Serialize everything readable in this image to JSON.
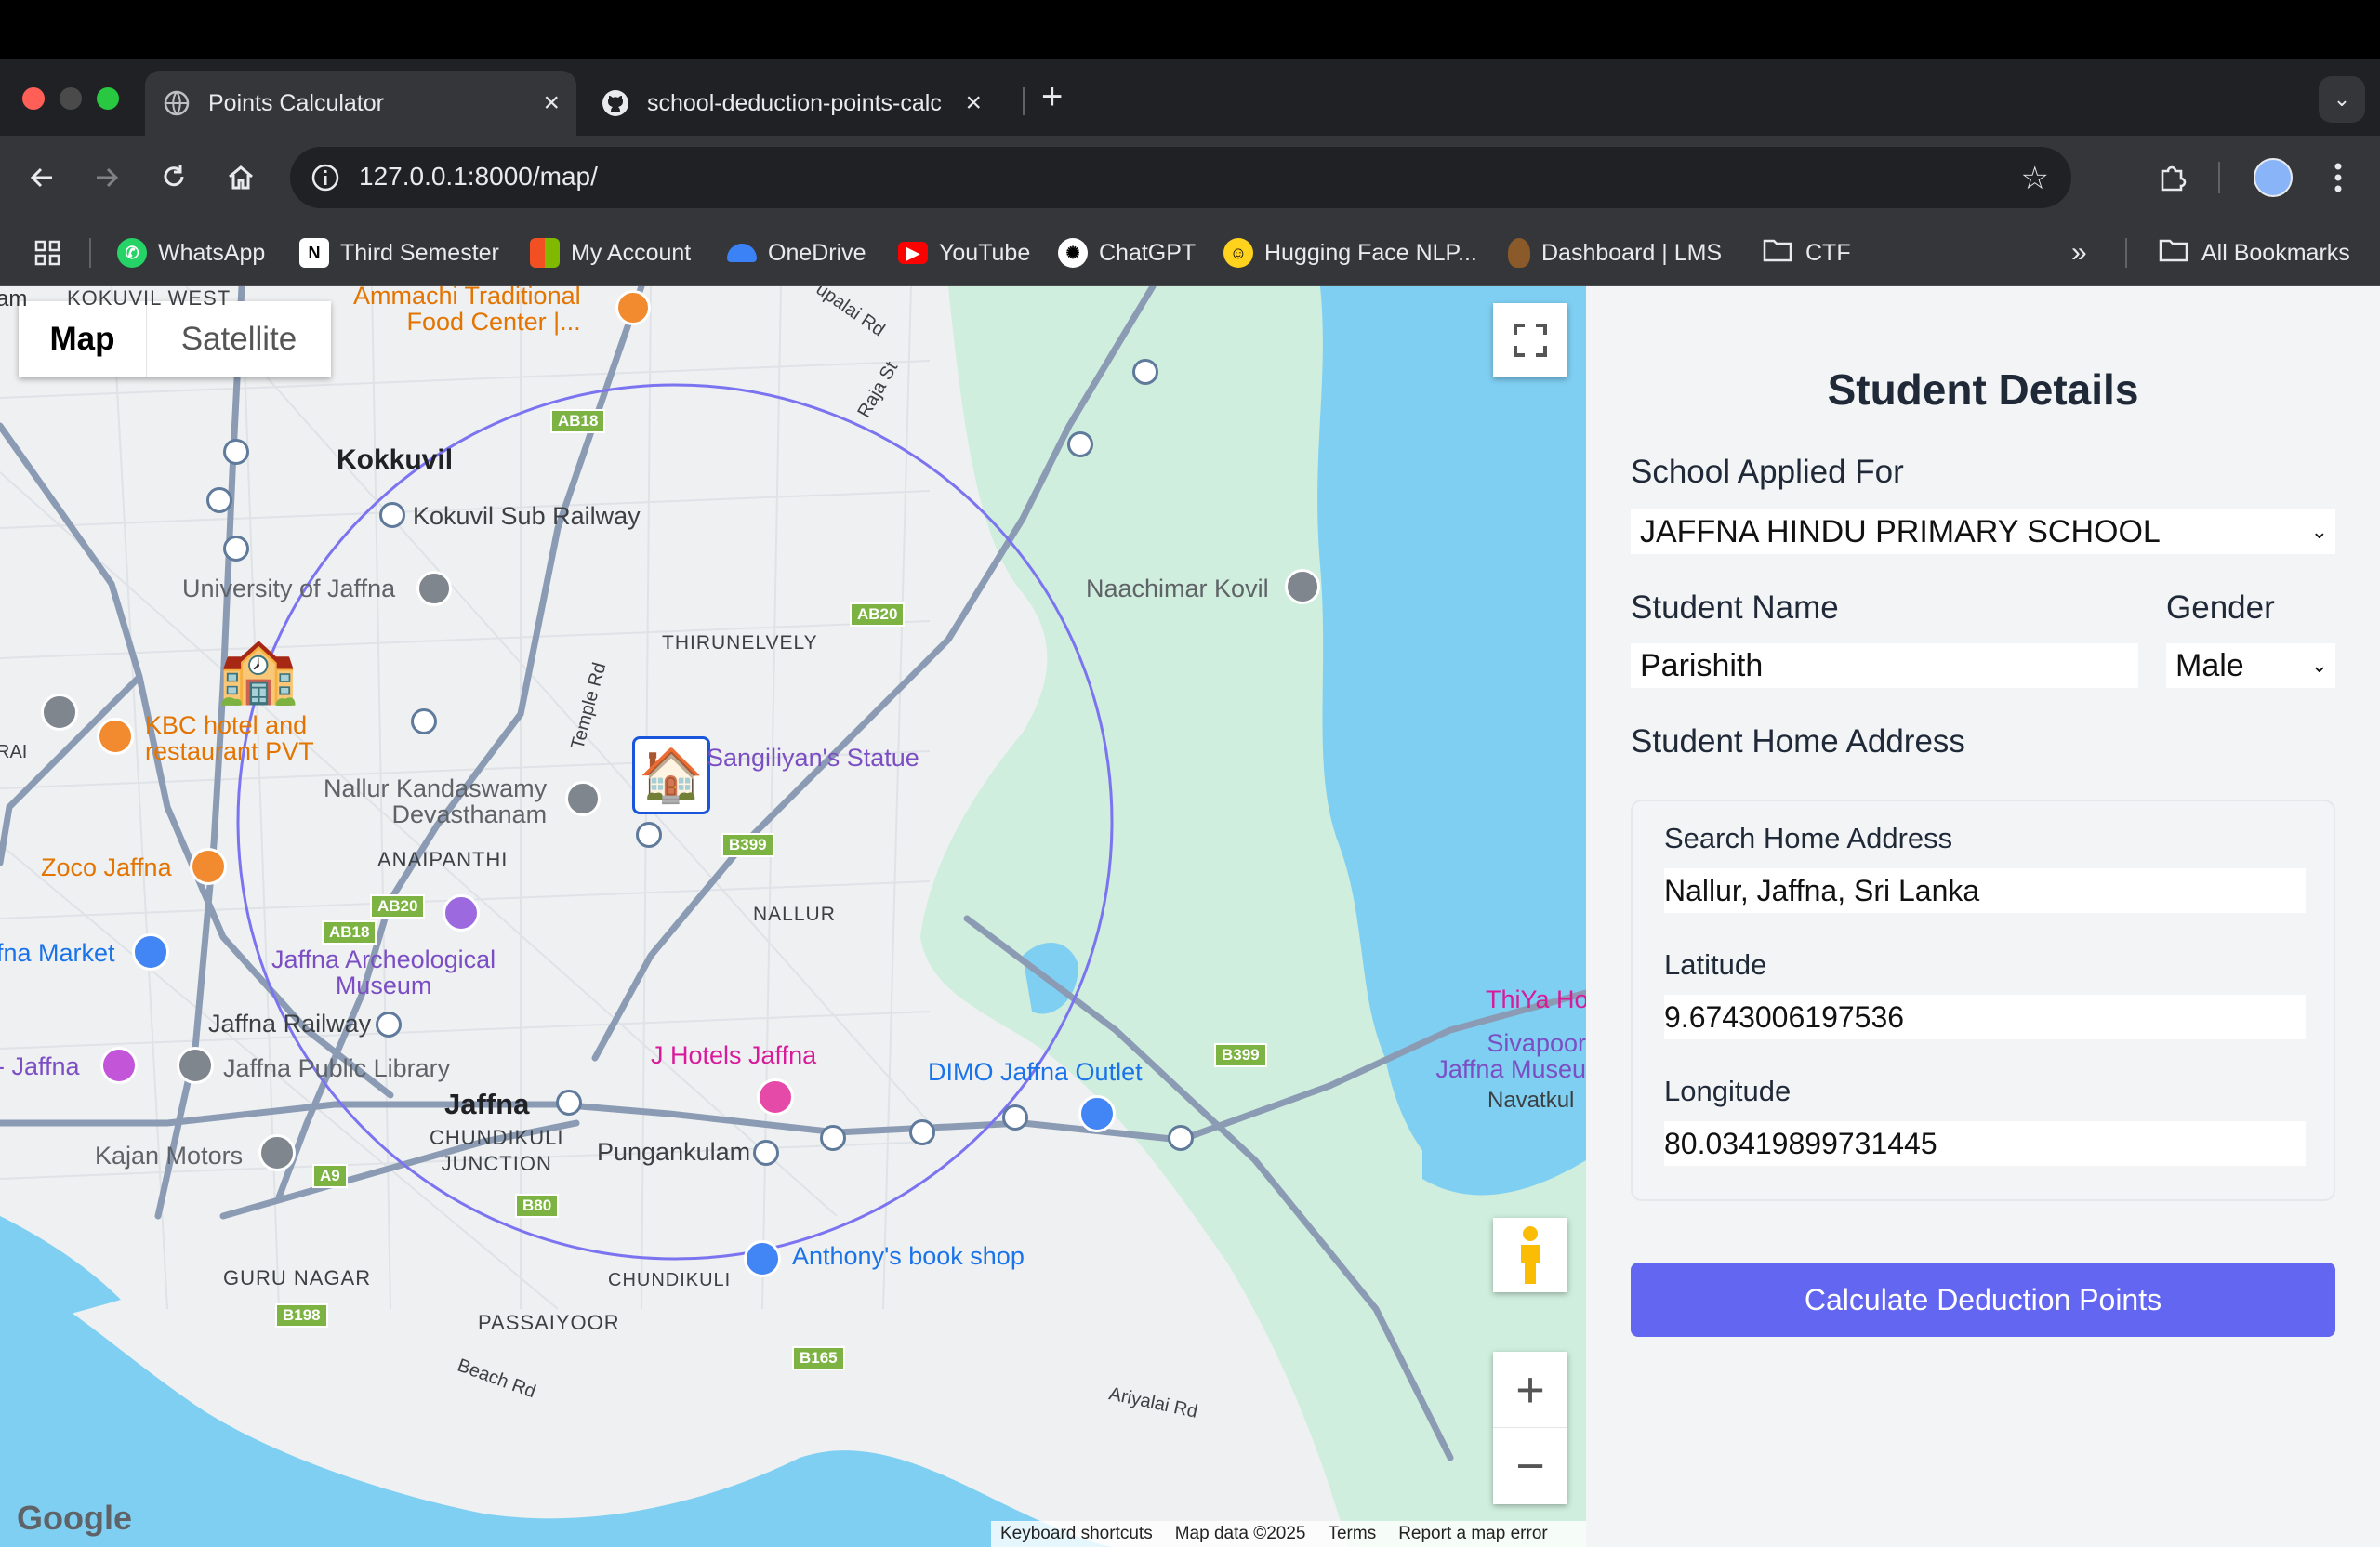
{
  "browser": {
    "tabs": [
      {
        "title": "Points Calculator",
        "active": true
      },
      {
        "title": "school-deduction-points-calc",
        "active": false
      }
    ],
    "url": "127.0.0.1:8000/map/",
    "bookmarks": [
      {
        "label": "WhatsApp",
        "icon": "whatsapp-icon",
        "color": "#25d366"
      },
      {
        "label": "Third Semester",
        "icon": "notion-icon",
        "color": "#ffffff"
      },
      {
        "label": "My Account",
        "icon": "microsoft-icon",
        "color": "#f25022"
      },
      {
        "label": "OneDrive",
        "icon": "cloud-icon",
        "color": "#3b82f6"
      },
      {
        "label": "YouTube",
        "icon": "youtube-icon",
        "color": "#ff0000"
      },
      {
        "label": "ChatGPT",
        "icon": "chatgpt-icon",
        "color": "#ffffff"
      },
      {
        "label": "Hugging Face NLP...",
        "icon": "hugging-face-icon",
        "color": "#ffd21e"
      },
      {
        "label": "Dashboard | LMS",
        "icon": "lms-icon",
        "color": "#8b5a2b"
      },
      {
        "label": "CTF",
        "icon": "folder-icon",
        "color": "#e8eaed"
      }
    ],
    "all_bookmarks": "All Bookmarks"
  },
  "map": {
    "type_buttons": {
      "map": "Map",
      "satellite": "Satellite"
    },
    "labels": {
      "kokuvil_west": "KOKUVIL WEST",
      "ammachi": "Ammachi Traditional\nFood Center |...",
      "kokkuvil": "Kokkuvil",
      "kokuvil_railway": "Kokuvil Sub Railway",
      "univ": "University of Jaffna",
      "thirunelvely": "THIRUNELVELY",
      "naachimar": "Naachimar Kovil",
      "kbc": "KBC hotel and\nrestaurant PVT",
      "sangiliyan": "Sangiliyan's Statue",
      "nallur_kandaswamy": "Nallur Kandaswamy\nDevasthanam",
      "anaipanthi": "ANAIPANTHI",
      "zoco": "Zoco Jaffna",
      "nallur": "NALLUR",
      "market": "fna Market",
      "archeo": "Jaffna Archeological\nMuseum",
      "railway": "Jaffna Railway",
      "jaffna_left": "- Jaffna",
      "public_library": "Jaffna Public Library",
      "jhotels": "J Hotels Jaffna",
      "dimo": "DIMO Jaffna Outlet",
      "thiya": "ThiYa Ho",
      "sivapoor": "Sivapoor\nJaffna Museu",
      "navatkul": "Navatkul",
      "jaffna": "Jaffna",
      "chundikuli_junction": "CHUNDIKULI\nJUNCTION",
      "pungankulam": "Pungankulam",
      "kajan": "Kajan Motors",
      "guru_nagar": "GURU NAGAR",
      "chundikuli": "CHUNDIKULI",
      "anthony": "Anthony's book shop",
      "passaiyoor": "PASSAIYOOR",
      "beach_rd": "Beach Rd",
      "ariyalai_rd": "Ariyalai Rd",
      "temple_rd": "Temple Rd",
      "raja_st": "Raja St",
      "upalai_rd": "upalai Rd",
      "rai": "RAI",
      "am": "am"
    },
    "road_shields": [
      "AB18",
      "AB20",
      "B399",
      "AB18",
      "AB20",
      "A9",
      "B80",
      "B198",
      "B165",
      "B399"
    ],
    "footer": {
      "logo": "Google",
      "keyboard": "Keyboard shortcuts",
      "mapdata": "Map data ©2025",
      "terms": "Terms",
      "report": "Report a map error"
    }
  },
  "form": {
    "title": "Student Details",
    "school_label": "School Applied For",
    "school_value": "JAFFNA HINDU PRIMARY SCHOOL",
    "name_label": "Student Name",
    "name_value": "Parishith",
    "gender_label": "Gender",
    "gender_value": "Male",
    "address_label": "Student Home Address",
    "search_label": "Search Home Address",
    "search_value": "Nallur, Jaffna, Sri Lanka",
    "lat_label": "Latitude",
    "lat_value": "9.6743006197536",
    "lng_label": "Longitude",
    "lng_value": "80.03419899731445",
    "submit": "Calculate Deduction Points",
    "accent": "#6366f1"
  }
}
